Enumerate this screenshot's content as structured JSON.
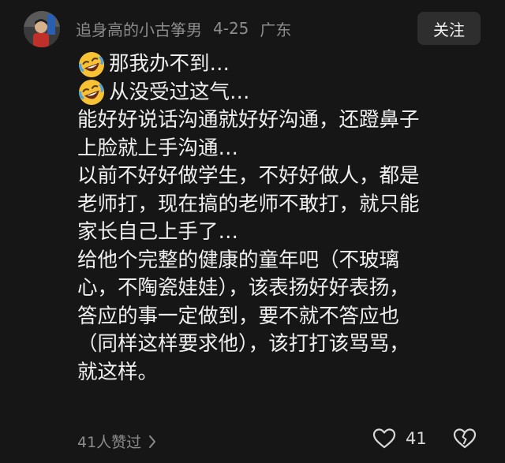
{
  "comment": {
    "username": "追身高的小古筝男",
    "date": "4-25",
    "location": "广东",
    "follow_label": "关注",
    "lines": [
      {
        "emoji": "rofl-emoji",
        "text": "那我办不到…"
      },
      {
        "emoji": "rofl-emoji",
        "text": "从没受过这气…"
      },
      {
        "text": "能好好说话沟通就好好沟通，还蹬鼻子"
      },
      {
        "text": "上脸就上手沟通…"
      },
      {
        "text": "以前不好好做学生，不好好做人，都是"
      },
      {
        "text": "老师打，现在搞的老师不敢打，就只能"
      },
      {
        "text": "家长自己上手了…"
      },
      {
        "text": "给他个完整的健康的童年吧（不玻璃"
      },
      {
        "text": "心，不陶瓷娃娃），该表扬好好表扬，"
      },
      {
        "text": "答应的事一定做到，要不就不答应也"
      },
      {
        "text": "（同样这样要求他），该打打该骂骂，"
      },
      {
        "text": "就这样。"
      }
    ],
    "liked_by": "41人赞过",
    "like_count": "41"
  },
  "icons": {
    "chevron": "chevron-right-icon",
    "heart": "heart-outline-icon",
    "broken_heart": "broken-heart-icon"
  }
}
